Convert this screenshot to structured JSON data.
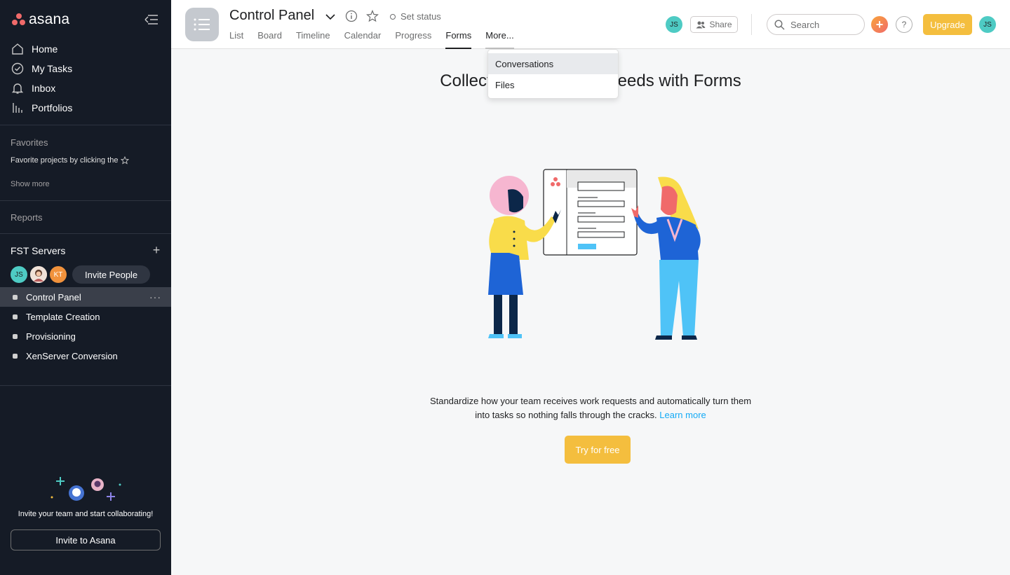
{
  "app": {
    "name": "asana"
  },
  "sidebar": {
    "nav": [
      {
        "label": "Home",
        "icon": "home-icon"
      },
      {
        "label": "My Tasks",
        "icon": "check-circle-icon"
      },
      {
        "label": "Inbox",
        "icon": "bell-icon"
      },
      {
        "label": "Portfolios",
        "icon": "bar-chart-icon"
      }
    ],
    "favorites_title": "Favorites",
    "favorites_hint": "Favorite projects by clicking the",
    "show_more": "Show more",
    "reports": "Reports",
    "team_name": "FST Servers",
    "members": [
      {
        "initials": "JS",
        "color": "#4ecbc4"
      },
      {
        "initials": "",
        "color": "#e8d5c8"
      },
      {
        "initials": "KT",
        "color": "#f1923c"
      }
    ],
    "invite_people": "Invite People",
    "projects": [
      {
        "label": "Control Panel",
        "active": true
      },
      {
        "label": "Template Creation"
      },
      {
        "label": "Provisioning"
      },
      {
        "label": "XenServer Conversion"
      }
    ],
    "invite_text": "Invite your team and start collaborating!",
    "invite_button": "Invite to Asana"
  },
  "header": {
    "title": "Control Panel",
    "set_status": "Set status",
    "tabs": [
      "List",
      "Board",
      "Timeline",
      "Calendar",
      "Progress",
      "Forms",
      "More..."
    ],
    "active_tab": "Forms",
    "member_initials": "JS",
    "share": "Share",
    "search_placeholder": "Search",
    "help": "?",
    "upgrade": "Upgrade",
    "user_initials": "JS"
  },
  "dropdown": {
    "items": [
      "Conversations",
      "Files"
    ],
    "highlighted": "Conversations"
  },
  "main": {
    "title_left": "Collect th",
    "title_right": "needs with Forms",
    "description": "Standardize how your team receives work requests and automatically turn them into tasks so nothing falls through the cracks.",
    "learn_more": "Learn more",
    "cta": "Try for free"
  },
  "colors": {
    "sidebar_bg": "#151b26",
    "accent": "#f4be3e",
    "brand": "#f06a6a",
    "link": "#14aaf5"
  }
}
